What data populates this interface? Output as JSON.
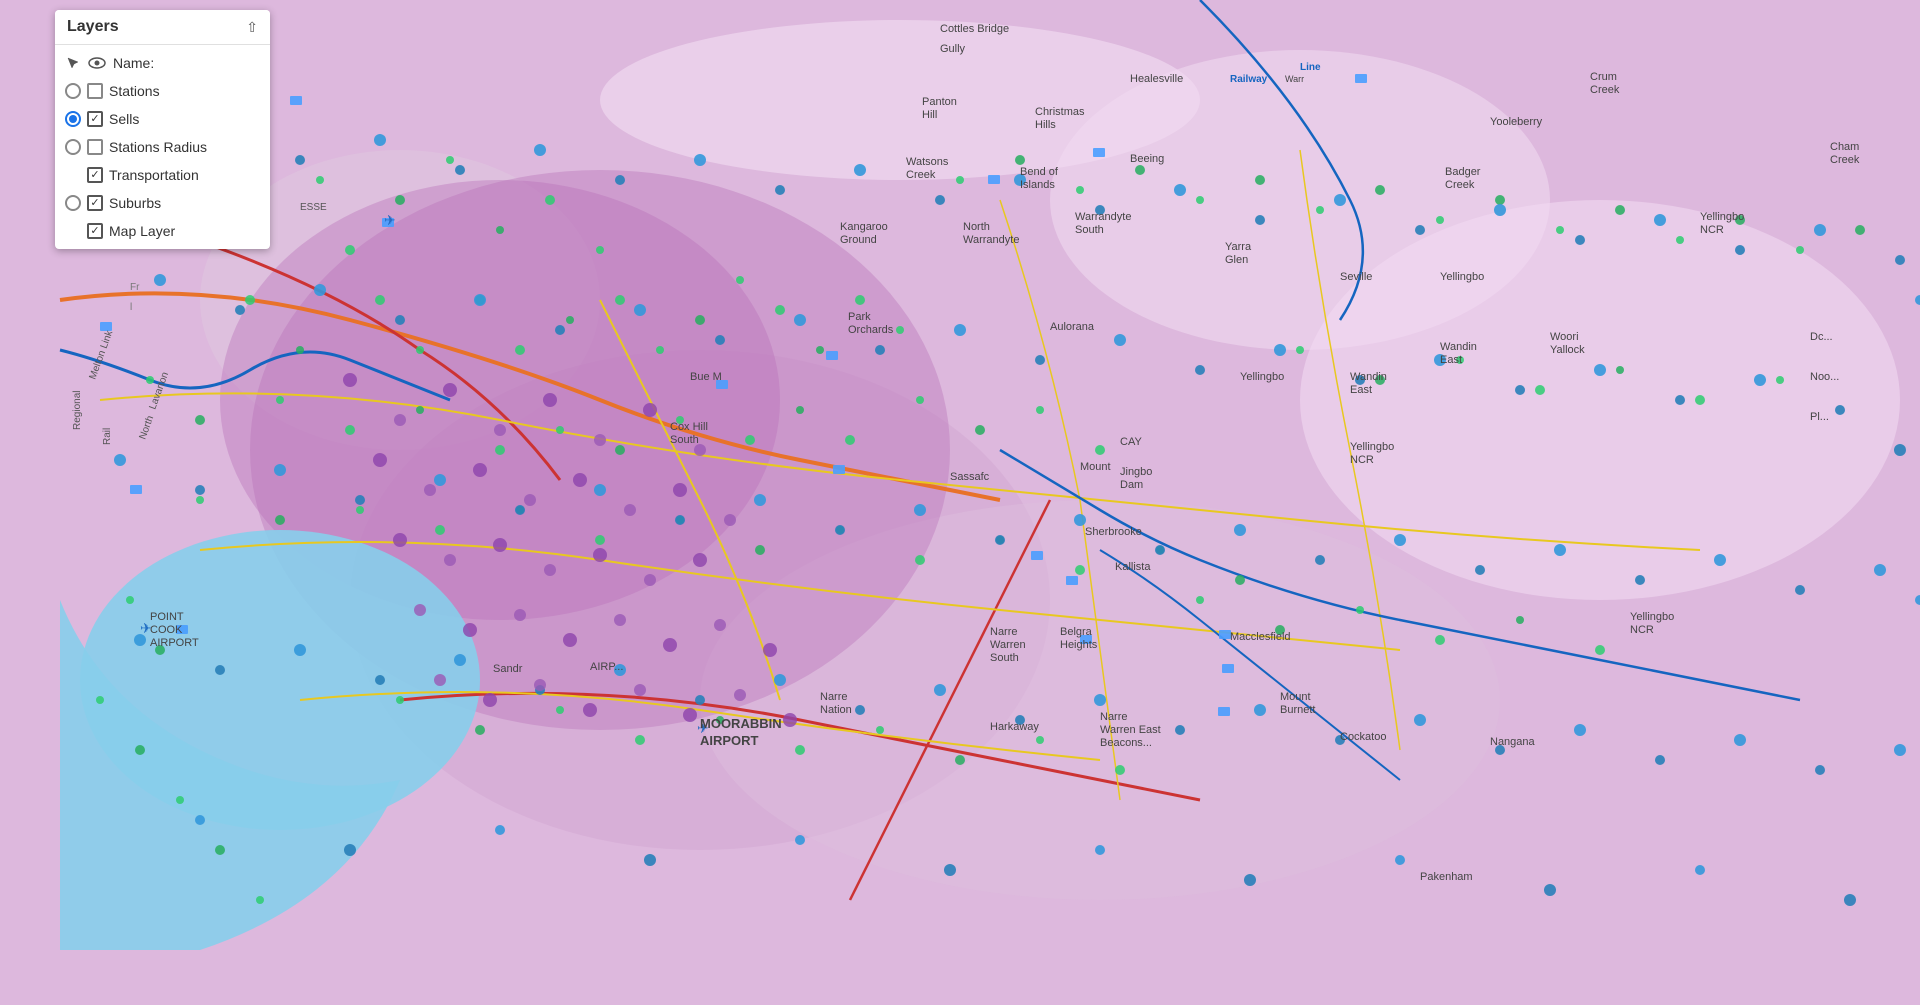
{
  "layers_panel": {
    "title": "Layers",
    "header_label": "Name:",
    "collapse_icon": "chevron-up",
    "layers": [
      {
        "id": "stations",
        "label": "Stations",
        "has_radio": true,
        "radio_selected": false,
        "has_checkbox": true,
        "checkbox_checked": false,
        "visible": true
      },
      {
        "id": "sells",
        "label": "Sells",
        "has_radio": true,
        "radio_selected": true,
        "has_checkbox": true,
        "checkbox_checked": true,
        "visible": true
      },
      {
        "id": "stations_radius",
        "label": "Stations Radius",
        "has_radio": true,
        "radio_selected": false,
        "has_checkbox": true,
        "checkbox_checked": false,
        "visible": true
      },
      {
        "id": "transportation",
        "label": "Transportation",
        "has_radio": false,
        "radio_selected": false,
        "has_checkbox": true,
        "checkbox_checked": true,
        "visible": true
      },
      {
        "id": "suburbs",
        "label": "Suburbs",
        "has_radio": true,
        "radio_selected": false,
        "has_checkbox": true,
        "checkbox_checked": true,
        "visible": true
      },
      {
        "id": "map_layer",
        "label": "Map Layer",
        "has_radio": false,
        "radio_selected": false,
        "has_checkbox": true,
        "checkbox_checked": true,
        "visible": true
      }
    ]
  },
  "map": {
    "background_color": "#e8d5e8",
    "accent_color": "#c470c4"
  }
}
